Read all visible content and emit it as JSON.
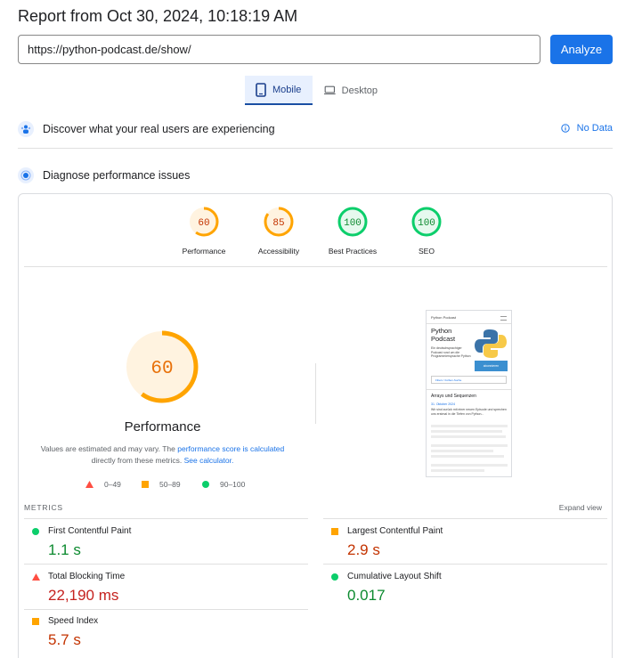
{
  "report": {
    "title": "Report from Oct 30, 2024, 10:18:19 AM"
  },
  "search": {
    "url": "https://python-podcast.de/show/",
    "analyze_label": "Analyze"
  },
  "tabs": {
    "mobile": "Mobile",
    "desktop": "Desktop"
  },
  "field_data": {
    "heading": "Discover what your real users are experiencing",
    "status": "No Data"
  },
  "diagnose": {
    "heading": "Diagnose performance issues"
  },
  "scores": [
    {
      "label": "Performance",
      "value": "60",
      "fraction": 0.6,
      "color": "#ffa400"
    },
    {
      "label": "Accessibility",
      "value": "85",
      "fraction": 0.85,
      "color": "#ffa400"
    },
    {
      "label": "Best Practices",
      "value": "100",
      "fraction": 1.0,
      "color": "#0cce6b"
    },
    {
      "label": "SEO",
      "value": "100",
      "fraction": 1.0,
      "color": "#0cce6b"
    }
  ],
  "performance": {
    "score": "60",
    "fraction": 0.6,
    "title": "Performance",
    "note_prefix": "Values are estimated and may vary. The",
    "note_link1": "performance score is calculated",
    "note_middle": "directly from these metrics.",
    "note_link2": "See calculator."
  },
  "legend": {
    "fail": "0–49",
    "average": "50–89",
    "pass": "90–100"
  },
  "metrics": {
    "label": "METRICS",
    "expand": "Expand view",
    "fcp": {
      "name": "First Contentful Paint",
      "value": "1.1 s"
    },
    "lcp": {
      "name": "Largest Contentful Paint",
      "value": "2.9 s"
    },
    "tbt": {
      "name": "Total Blocking Time",
      "value": "22,190 ms"
    },
    "cls": {
      "name": "Cumulative Layout Shift",
      "value": "0.017"
    },
    "si": {
      "name": "Speed Index",
      "value": "5.7 s"
    }
  },
  "thumbnail": {
    "site_name": "Python Podcast",
    "hero_title": "Python Podcast",
    "hero_text": "Ein deutschsprachiger Podcast rund um die Programmiersprache Python",
    "button": "abonnieren",
    "filter": "Filters / Folben-Suche",
    "post_title": "Arrays und Sequenzen",
    "post_date": "31. Oktober 2024",
    "post_text": "Wir sind zurück mit einer neuen Episode und sprechen uns erstmal in die Tiefen von Python..."
  },
  "colors": {
    "accent": "#1a73e8",
    "pass": "#0cce6b",
    "average": "#ffa400",
    "fail": "#ff4e42"
  }
}
